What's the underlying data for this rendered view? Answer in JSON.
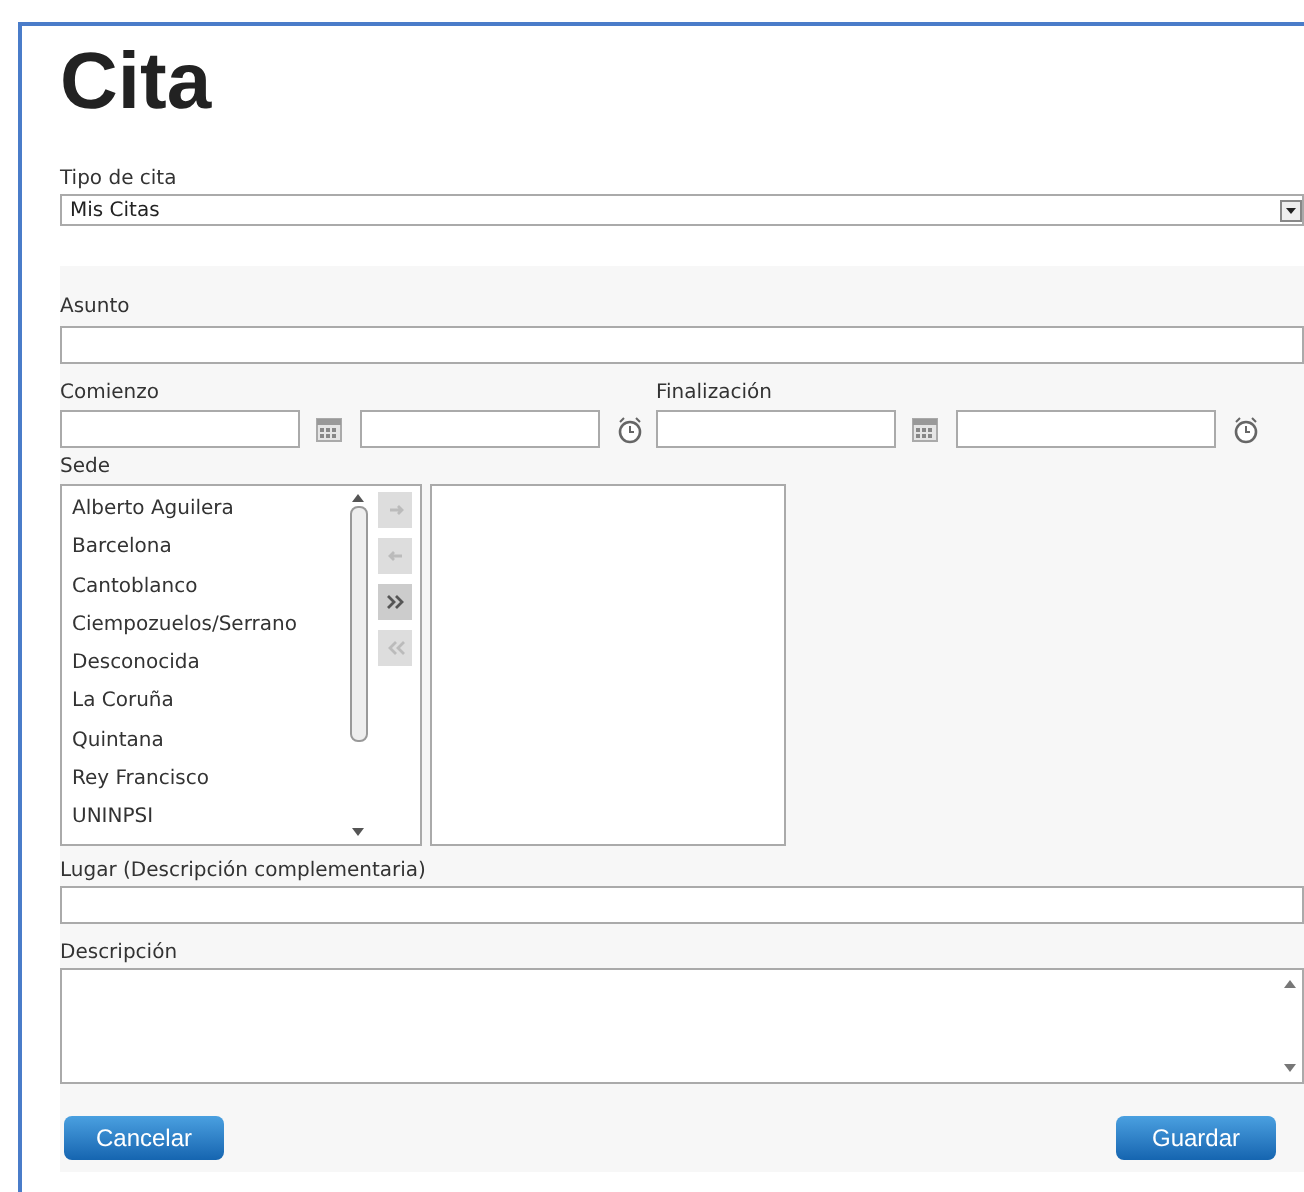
{
  "title": "Cita",
  "tipo": {
    "label": "Tipo de cita",
    "value": "Mis Citas"
  },
  "asunto": {
    "label": "Asunto"
  },
  "comienzo": {
    "label": "Comienzo"
  },
  "finalizacion": {
    "label": "Finalización"
  },
  "sede": {
    "label": "Sede",
    "options": [
      "Alberto Aguilera",
      "Barcelona",
      "Cantoblanco",
      "Ciempozuelos/Serrano",
      "Desconocida",
      "La Coruña",
      "Quintana",
      "Rey Francisco",
      "UNINPSI"
    ],
    "move_buttons": [
      {
        "kind": "right",
        "disabled": true
      },
      {
        "kind": "left",
        "disabled": true
      },
      {
        "kind": "all-right",
        "disabled": false
      },
      {
        "kind": "all-left",
        "disabled": true
      }
    ]
  },
  "lugar": {
    "label": "Lugar (Descripción complementaria)"
  },
  "descripcion": {
    "label": "Descripción"
  },
  "buttons": {
    "cancel": "Cancelar",
    "save": "Guardar"
  }
}
